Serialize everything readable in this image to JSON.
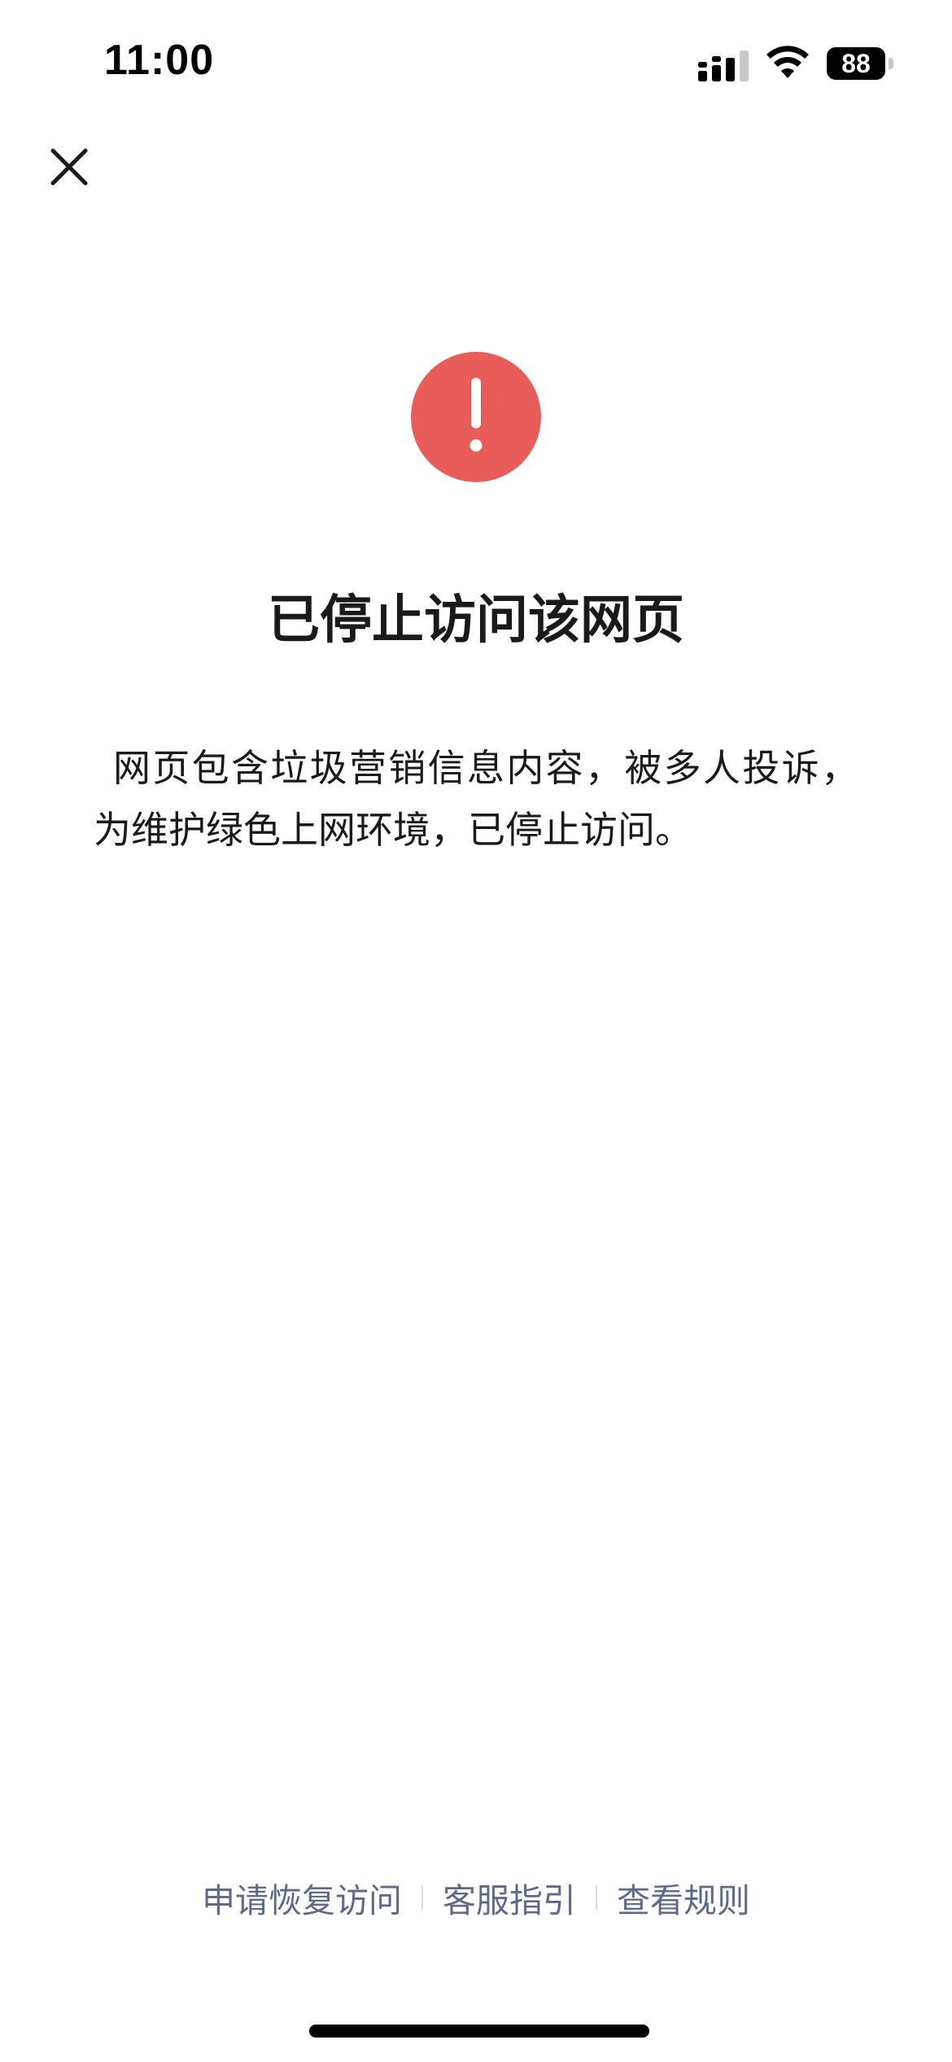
{
  "status_bar": {
    "time": "11:00",
    "battery_level": "88",
    "signal_icon": "cellular-signal-icon",
    "wifi_icon": "wifi-icon"
  },
  "toolbar": {
    "close_icon": "close-icon"
  },
  "alert": {
    "icon": "exclamation-circle-icon",
    "icon_color": "#E85D5A",
    "title": "已停止访问该网页",
    "message": "网页包含垃圾营销信息内容，被多人投诉，为维护绿色上网环境，已停止访问。"
  },
  "footer": {
    "links": [
      {
        "label": "申请恢复访问"
      },
      {
        "label": "客服指引"
      },
      {
        "label": "查看规则"
      }
    ],
    "link_color": "#5C6B8A"
  }
}
